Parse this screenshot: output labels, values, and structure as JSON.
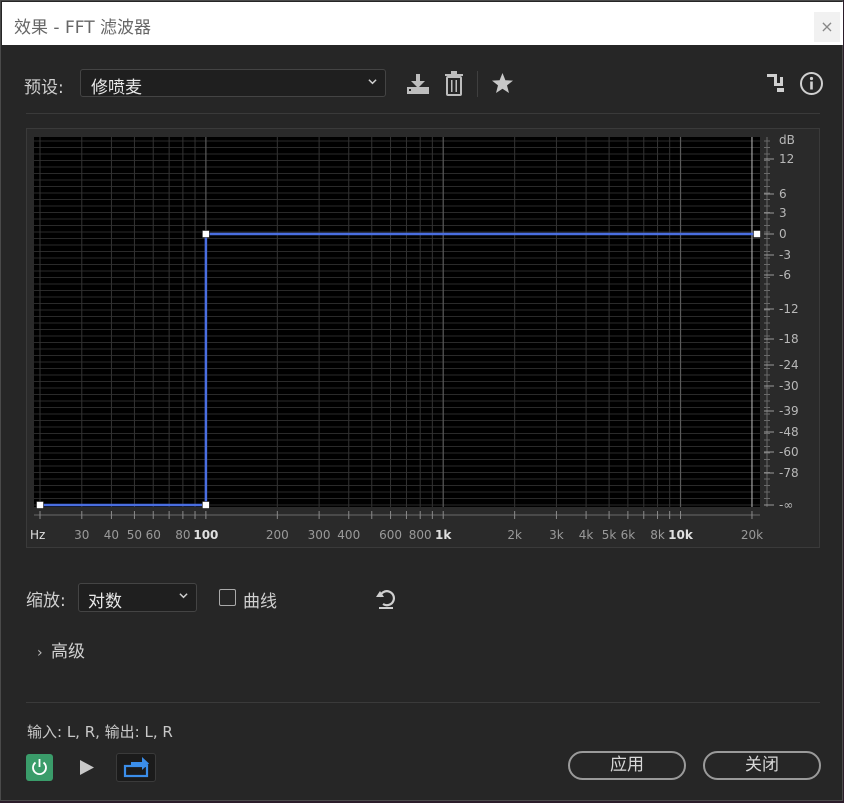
{
  "window": {
    "title": "效果 - FFT 滤波器",
    "close_glyph": "×"
  },
  "preset": {
    "label": "预设:",
    "value": "修喷麦"
  },
  "toolbar": {
    "save_icon": "download-save-icon",
    "delete_icon": "trash-icon",
    "favorite_icon": "star-icon",
    "routing_icon": "routing-icon",
    "info_icon": "info-icon"
  },
  "chart_data": {
    "type": "line",
    "xscale": "log",
    "x_ticks": [
      "Hz",
      "30",
      "40",
      "50",
      "60",
      "80",
      "100",
      "200",
      "300",
      "400",
      "600",
      "800",
      "1k",
      "2k",
      "3k",
      "4k",
      "5k",
      "6k",
      "8k",
      "10k",
      "20k"
    ],
    "y_unit": "dB",
    "y_ticks": [
      "12",
      "6",
      "3",
      "0",
      "-3",
      "-6",
      "-12",
      "-18",
      "-24",
      "-30",
      "-39",
      "-48",
      "-60",
      "-78",
      "-∞"
    ],
    "series": [
      {
        "points": [
          [
            20,
            "-∞"
          ],
          [
            100,
            "-∞"
          ],
          [
            100,
            0
          ],
          [
            14000,
            0
          ],
          [
            21000,
            0
          ]
        ]
      }
    ],
    "control_points": [
      [
        20,
        "-∞"
      ],
      [
        100,
        "-∞"
      ],
      [
        100,
        0
      ],
      [
        21000,
        0
      ]
    ],
    "line_color": "#4a6ee0",
    "grid": true
  },
  "zoom": {
    "label": "缩放:",
    "value": "对数"
  },
  "curve_option": {
    "label": "曲线",
    "checked": false
  },
  "reset_icon": "reset-icon",
  "advanced": {
    "caret": "›",
    "label": "高级"
  },
  "io_status": "输入: L, R,  输出: L, R",
  "footer": {
    "power_icon": "power-icon",
    "play_icon": "play-icon",
    "loop_icon": "loop-icon",
    "apply_label": "应用",
    "close_label": "关闭"
  },
  "colors": {
    "accent_green": "#3a9c6a",
    "loop_blue": "#3b8eea"
  }
}
